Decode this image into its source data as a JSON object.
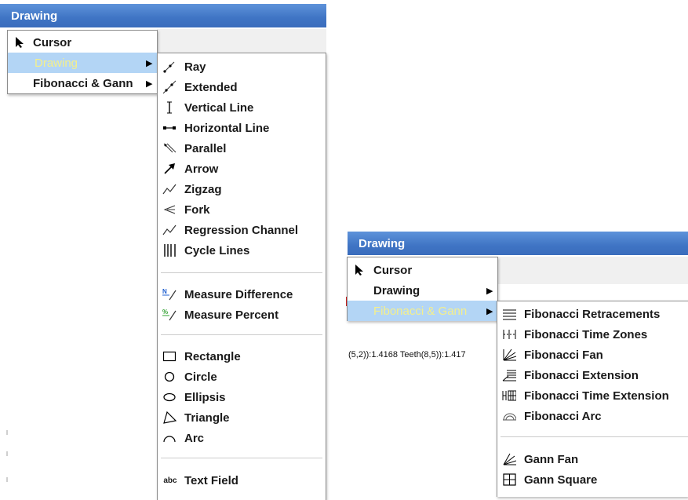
{
  "left": {
    "title": "Drawing",
    "main_menu": [
      {
        "label": "Cursor",
        "icon": "cursor-arrow-icon"
      },
      {
        "label": "Drawing",
        "icon": null,
        "submenu": true,
        "selected": true
      },
      {
        "label": "Fibonacci & Gann",
        "icon": null,
        "submenu": true
      }
    ],
    "drawing_submenu": {
      "group1": [
        "Ray",
        "Extended",
        "Vertical Line",
        "Horizontal Line",
        "Parallel",
        "Arrow",
        "Zigzag",
        "Fork",
        "Regression Channel",
        "Cycle Lines"
      ],
      "group2": [
        "Measure Difference",
        "Measure Percent"
      ],
      "group3": [
        "Rectangle",
        "Circle",
        "Ellipsis",
        "Triangle",
        "Arc"
      ],
      "group4": [
        "Text Field"
      ],
      "group4_icon_text": "abc"
    }
  },
  "right": {
    "title": "Drawing",
    "main_menu": [
      {
        "label": "Cursor"
      },
      {
        "label": "Drawing",
        "submenu": true
      },
      {
        "label": "Fibonacci & Gann",
        "submenu": true,
        "selected": true
      }
    ],
    "fib_submenu": {
      "group1": [
        "Fibonacci Retracements",
        "Fibonacci Time Zones",
        "Fibonacci Fan",
        "Fibonacci Extension",
        "Fibonacci Time Extension",
        "Fibonacci Arc"
      ],
      "group2": [
        "Gann Fan",
        "Gann Square"
      ]
    },
    "status_snippet": "(5,2)):1.4168 Teeth(8,5)):1.417"
  },
  "colors": {
    "title_bar": "#3f74c4",
    "selected_bg": "#b3d5f5",
    "selected_text": "#f4ef8c",
    "measure_icon_blue": "#2060d0",
    "measure_icon_green": "#30a030"
  }
}
